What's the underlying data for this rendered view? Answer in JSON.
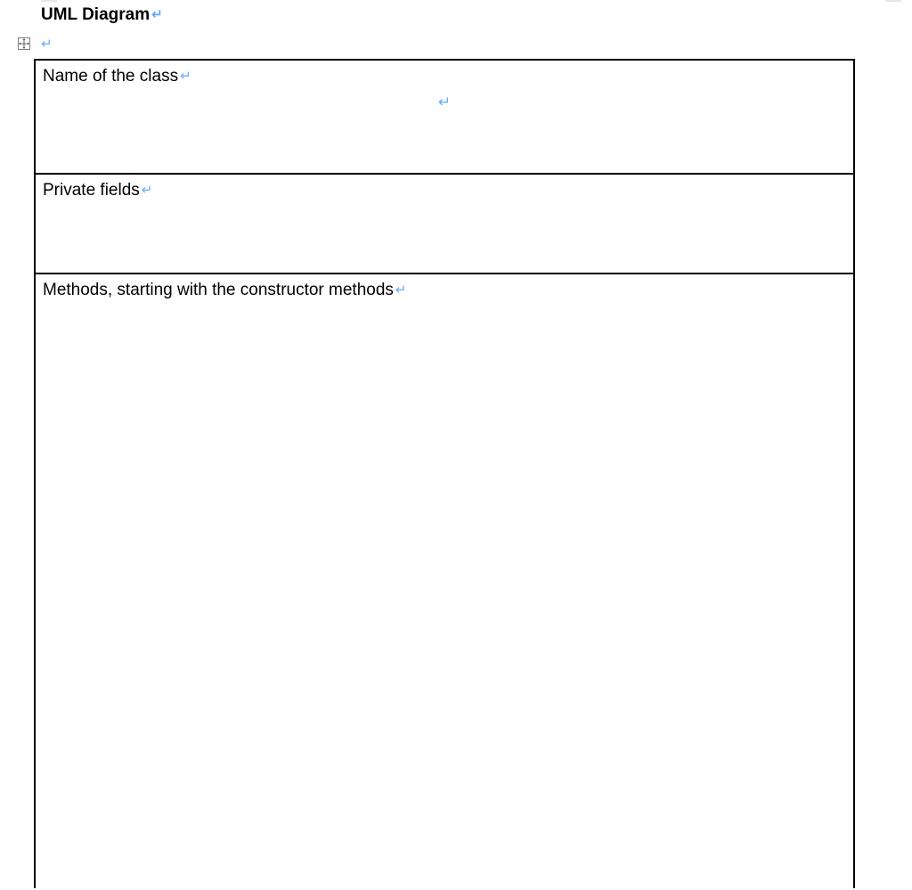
{
  "heading": "UML Diagram",
  "paragraph_mark": "↵",
  "table": {
    "rows": [
      {
        "label": "Name of the class"
      },
      {
        "label": "Private fields"
      },
      {
        "label": "Methods, starting with the constructor methods"
      }
    ]
  }
}
